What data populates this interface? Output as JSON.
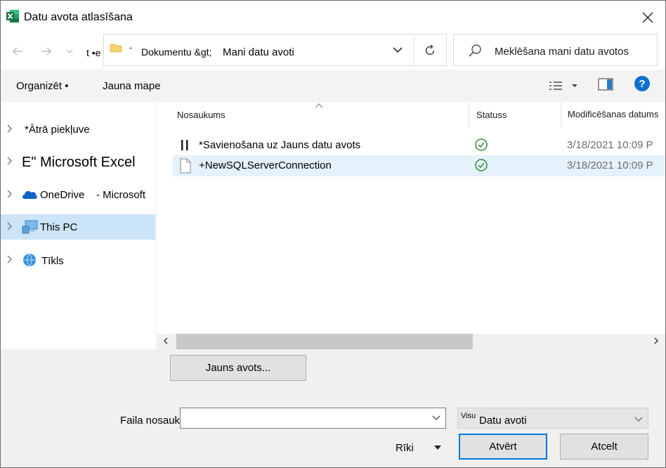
{
  "window": {
    "title": "Datu avota atlasīšana",
    "brand_color": "#1d6f42"
  },
  "navigation": {
    "back_icon": "arrow-left-icon",
    "forward_icon": "arrow-right-icon",
    "recent_icon": "chevron-down-icon",
    "up_text": "t •e"
  },
  "address": {
    "quote": "\"",
    "crumb1": "Dokumentu &gt;",
    "crumb2": "Mani datu avoti"
  },
  "search": {
    "placeholder": "Meklēšana mani datu avotos"
  },
  "toolbar": {
    "organize_label": "Organizēt •",
    "new_folder_label": "Jauna mape",
    "help_label": "?",
    "accent_color": "#0f6fd0"
  },
  "sidebar": {
    "items": [
      {
        "label": "*Ātrā piekļuve"
      },
      {
        "label": "E\" Microsoft Excel"
      },
      {
        "label": "OneDrive",
        "suffix": "- Microsoft"
      },
      {
        "label": "This PC",
        "selected": true
      },
      {
        "label": "Tīkls"
      }
    ],
    "selected_color": "#cce4f7"
  },
  "columns": {
    "name": "Nosaukums",
    "status": "Statuss",
    "modified": "Modificēšanas datums"
  },
  "files": [
    {
      "name": "*Savienošana uz Jauns datu avots",
      "date": "3/18/2021 10:09 P",
      "status": "ok"
    },
    {
      "name": "+NewSQLServerConnection",
      "date": "3/18/2021 10:09 P",
      "status": "ok"
    }
  ],
  "buttons": {
    "new_source": "Jauns avots...",
    "open": "Atvērt",
    "cancel": "Atcelt",
    "tools": "Rīki"
  },
  "filename": {
    "label": "Faila nosaukums:",
    "value": ""
  },
  "filter": {
    "prefix": "Visu",
    "value": "Datu avoti"
  }
}
